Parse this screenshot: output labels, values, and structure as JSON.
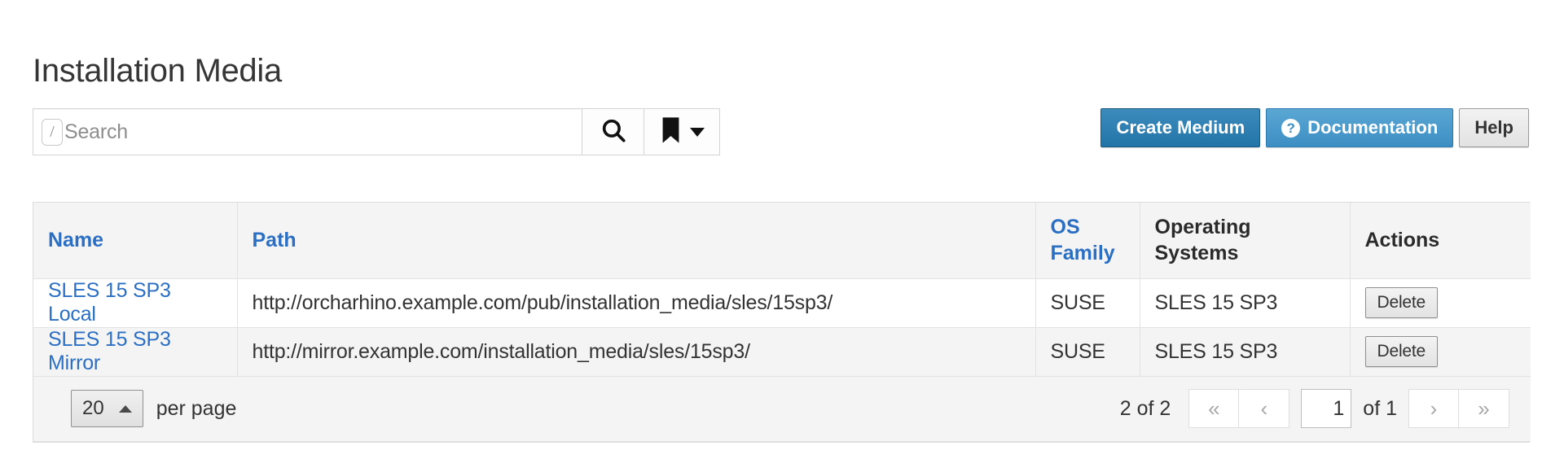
{
  "page_title": "Installation Media",
  "search": {
    "shortcut_badge": "/",
    "placeholder": "Search",
    "value": "",
    "search_icon": "search-icon",
    "bookmark_icon": "bookmark-icon"
  },
  "toolbar": {
    "create_label": "Create Medium",
    "documentation_label": "Documentation",
    "help_label": "Help",
    "colors": {
      "primary": "#2274a8",
      "info": "#3d8ec4",
      "default": "#e2e2e2",
      "link": "#2b6fc4"
    }
  },
  "table": {
    "columns": [
      {
        "label": "Name",
        "sortable": true
      },
      {
        "label": "Path",
        "sortable": true
      },
      {
        "label": "OS Family",
        "sortable": true
      },
      {
        "label": "Operating Systems",
        "sortable": false
      },
      {
        "label": "Actions",
        "sortable": false
      }
    ],
    "rows": [
      {
        "name": "SLES 15 SP3 Local",
        "path": "http://orcharhino.example.com/pub/installation_media/sles/15sp3/",
        "os_family": "SUSE",
        "operating_systems": "SLES 15 SP3",
        "action_label": "Delete"
      },
      {
        "name": "SLES 15 SP3 Mirror",
        "path": "http://mirror.example.com/installation_media/sles/15sp3/",
        "os_family": "SUSE",
        "operating_systems": "SLES 15 SP3",
        "action_label": "Delete"
      }
    ]
  },
  "footer": {
    "per_page_value": "20",
    "per_page_label": "per page",
    "result_count": "2 of  2",
    "first_icon": "«",
    "prev_icon": "‹",
    "next_icon": "›",
    "last_icon": "»",
    "current_page": "1",
    "of_label": "of  1"
  }
}
